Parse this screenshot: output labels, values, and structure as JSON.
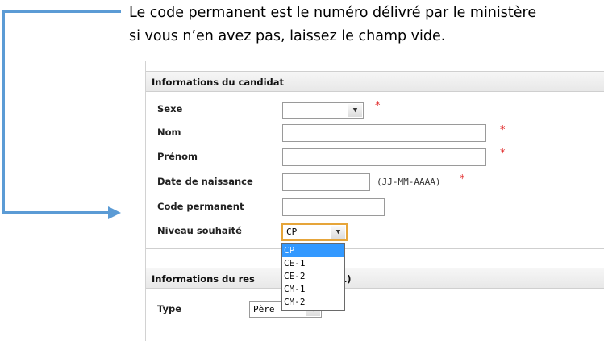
{
  "instruction": {
    "line1": "Le code permanent est le numéro délivré par le ministère",
    "line2": "si vous n’en avez pas, laissez le champ vide."
  },
  "candidate": {
    "header": "Informations du candidat",
    "sexe_label": "Sexe",
    "sexe_value": "",
    "nom_label": "Nom",
    "prenom_label": "Prénom",
    "dob_label": "Date de naissance",
    "dob_hint": "(JJ-MM-AAAA)",
    "code_label": "Code permanent",
    "niveau_label": "Niveau souhaité",
    "niveau_value": "CP",
    "required_mark": "*"
  },
  "niveau_options": [
    "CP",
    "CE-1",
    "CE-2",
    "CM-1",
    "CM-2"
  ],
  "niveau_selected_index": 0,
  "responsable": {
    "header_start": "Informations du res",
    "header_end": "(1)",
    "type_label": "Type",
    "type_value": "Père"
  },
  "colors": {
    "arrow": "#5b9bd5",
    "required": "#e02020",
    "focus_border": "#e6a53a",
    "option_highlight": "#3399ff"
  }
}
